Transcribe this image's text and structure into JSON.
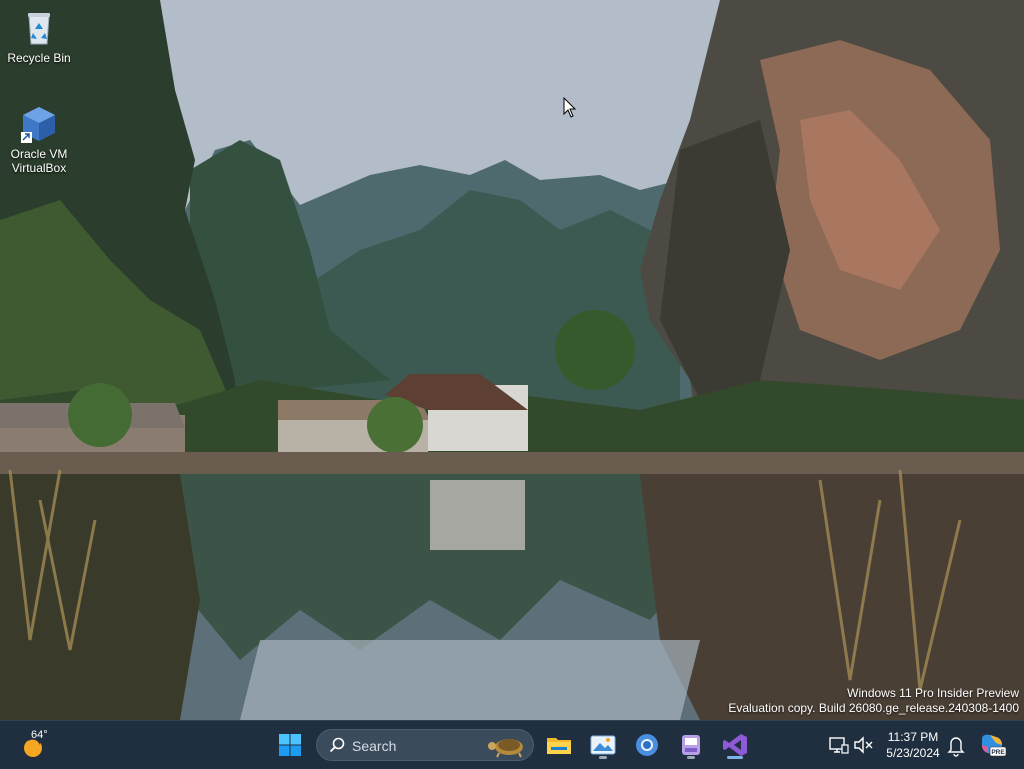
{
  "desktop": {
    "icons": [
      {
        "name": "Recycle Bin"
      },
      {
        "name": "Oracle VM VirtualBox"
      }
    ]
  },
  "watermark": {
    "line1": "Windows 11 Pro Insider Preview",
    "line2": "Evaluation copy. Build 26080.ge_release.240308-1400"
  },
  "taskbar": {
    "weather": {
      "temp": "64°",
      "icon": "weather-sun-icon"
    },
    "start_icon": "windows-start-icon",
    "search": {
      "label": "Search"
    },
    "apps": [
      {
        "name": "File Explorer",
        "icon": "file-explorer-icon"
      },
      {
        "name": "Photos",
        "icon": "photos-icon"
      },
      {
        "name": "Chromium",
        "icon": "chromium-icon"
      },
      {
        "name": "App",
        "icon": "app-icon"
      },
      {
        "name": "Visual Studio",
        "icon": "visual-studio-icon"
      }
    ],
    "tray": {
      "time": "11:37 PM",
      "date": "5/23/2024"
    }
  },
  "colors": {
    "taskbar_bg": "#1f2f40",
    "accent": "#0078d4"
  }
}
